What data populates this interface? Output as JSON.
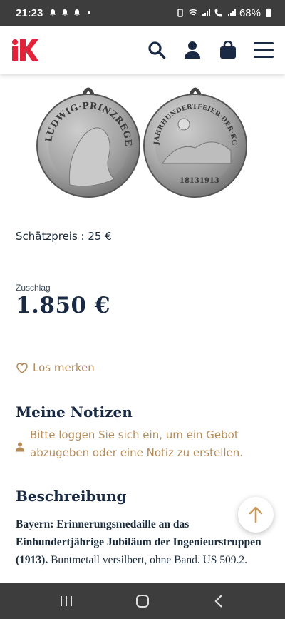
{
  "status_bar": {
    "time": "21:23",
    "battery": "68%"
  },
  "header": {
    "logo_icon": "kuenker-k-logo",
    "icons": [
      "search-icon",
      "user-icon",
      "bag-icon",
      "menu-icon"
    ],
    "accent_color": "#e3233a",
    "icon_color": "#1a2a44"
  },
  "medal": {
    "obverse_legend": "LUDWIG·PRINZREGENT·VON·BAYERN",
    "reverse_legend": "JAHRHUNDERTFEIER·DER·KGL·BAYR·INGENIEURTRUPPEN",
    "year_left": "1813",
    "year_right": "1913"
  },
  "lot": {
    "estimate": "Schätzpreis : 25 €",
    "hammer_label": "Zuschlag",
    "hammer_value": "1.850 €",
    "watch_label": "Los merken"
  },
  "notes": {
    "title": "Meine Notizen",
    "login_message": "Bitte loggen Sie sich ein, um ein Gebot abzugeben oder eine Notiz zu erstellen."
  },
  "description": {
    "title": "Beschreibung",
    "bold_text": "Bayern: Erinnerungsmedaille an das Einhundertjährige Jubiläum der Ingenieurstruppen (1913).",
    "text": "Buntmetall versilbert, ohne Band. US 509.2."
  },
  "colors": {
    "gold": "#b38c5a",
    "navy": "#1a2a44"
  }
}
